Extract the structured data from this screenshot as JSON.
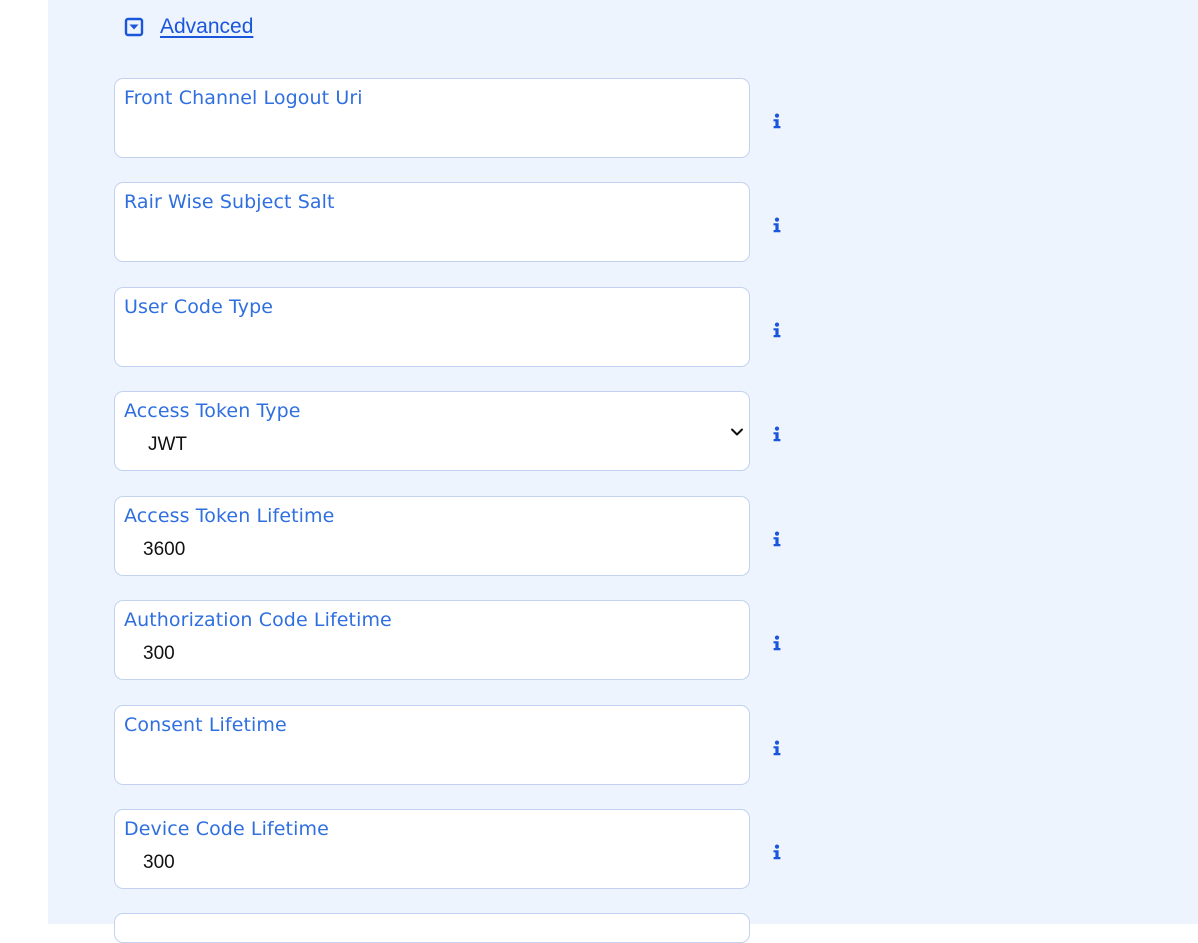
{
  "advanced": {
    "label": "Advanced",
    "icon": "collapse-toggle-icon",
    "accent_color": "#1a56db"
  },
  "fields": [
    {
      "key": "front_channel_logout_uri",
      "label": "Front Channel Logout Uri",
      "value": "",
      "type": "text"
    },
    {
      "key": "pair_wise_subject_salt",
      "label": "Rair Wise Subject Salt",
      "value": "",
      "type": "text"
    },
    {
      "key": "user_code_type",
      "label": "User Code Type",
      "value": "",
      "type": "text"
    },
    {
      "key": "access_token_type",
      "label": "Access Token Type",
      "value": "JWT",
      "type": "select"
    },
    {
      "key": "access_token_lifetime",
      "label": "Access Token Lifetime",
      "value": "3600",
      "type": "text"
    },
    {
      "key": "authorization_code_lifetime",
      "label": "Authorization Code Lifetime",
      "value": "300",
      "type": "text"
    },
    {
      "key": "consent_lifetime",
      "label": "Consent Lifetime",
      "value": "",
      "type": "text"
    },
    {
      "key": "device_code_lifetime",
      "label": "Device Code Lifetime",
      "value": "300",
      "type": "text"
    }
  ],
  "info_icon": "info-icon",
  "colors": {
    "panel_background": "#eef4fe",
    "label": "#2f6fe0",
    "border": "#c3d3ef",
    "info": "#1a56db"
  }
}
